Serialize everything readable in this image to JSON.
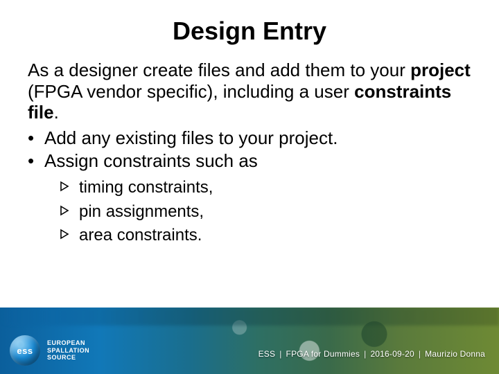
{
  "title": "Design Entry",
  "intro": {
    "pre": "As a designer create files and add them to your ",
    "bold1": "project",
    "mid": " (FPGA vendor specific), including a user ",
    "bold2": "constraints file",
    "post": "."
  },
  "bullets": [
    " Add any existing files to your project.",
    "Assign constraints such as"
  ],
  "sub_bullets": [
    "timing constraints,",
    "pin assignments,",
    "area constraints."
  ],
  "logo": {
    "abbr": "ess",
    "line1": "EUROPEAN",
    "line2": "SPALLATION",
    "line3": "SOURCE"
  },
  "footer": {
    "org": "ESS",
    "deck": "FPGA for Dummies",
    "date": "2016-09-20",
    "author": "Maurizio Donna",
    "sep": "|"
  }
}
